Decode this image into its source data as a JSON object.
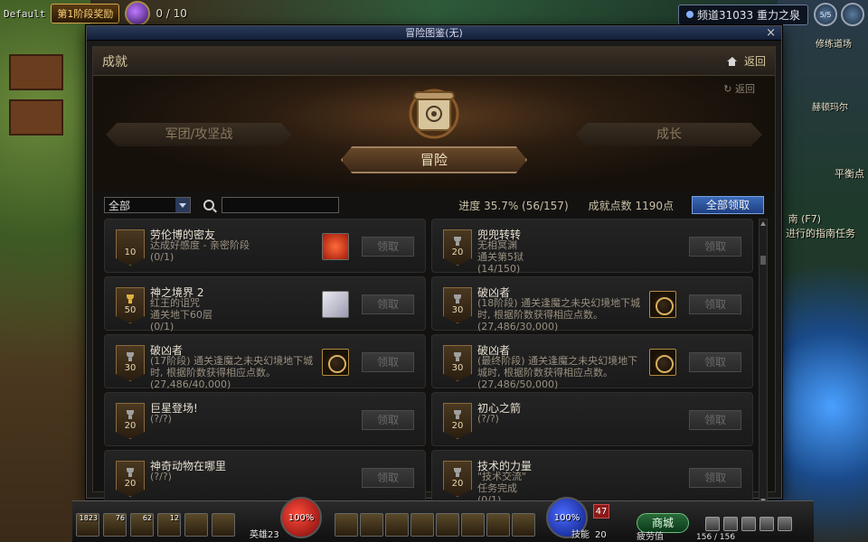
{
  "hud_top": {
    "default_label": "Default",
    "event_label": "第1阶段奖励",
    "counter": "0 / 10",
    "channel": "频道31033 重力之泉",
    "round_btn_label": "5/5"
  },
  "side_notes": {
    "npc_sign_1": "修练道场",
    "npc_name": "赫顿玛尔",
    "balance": "平衡点",
    "guide_key": "南 (F7)",
    "guide_task": "进行的指南任务"
  },
  "window": {
    "title": "冒险图鉴(无)",
    "close_label": "×",
    "panel_title": "成就",
    "back_label": "返回",
    "back_small_label": "返回"
  },
  "category_tabs": {
    "left": "军团/攻坚战",
    "center": "冒险",
    "right": "成长"
  },
  "filter": {
    "selected": "全部",
    "search_placeholder": "",
    "progress": "进度  35.7% (56/157)",
    "points": "成就点数  1190点",
    "claim_all": "全部领取"
  },
  "achievements": [
    {
      "points": "10",
      "trophy": "none",
      "title": "劳伦博的密友",
      "desc": "达成好感度 - 亲密阶段",
      "progress": "(0/1)",
      "reward": "heart",
      "button": "领取"
    },
    {
      "points": "20",
      "trophy": "silver",
      "title": "兜兜转转",
      "desc": "无相冥渊\n通关第5狱",
      "progress": "(14/150)",
      "reward": "",
      "button": "领取"
    },
    {
      "points": "50",
      "trophy": "gold",
      "title": "神之境界 2",
      "desc": "红王的诅咒\n通关地下60层",
      "progress": "(0/1)",
      "reward": "scroll",
      "button": "领取"
    },
    {
      "points": "30",
      "trophy": "silver",
      "title": "破凶者",
      "desc": "(18阶段) 通关逢魔之未央幻境地下城时, 根据阶数获得相应点数。",
      "progress": "(27,486/30,000)",
      "reward": "emblem",
      "button": "领取"
    },
    {
      "points": "30",
      "trophy": "silver",
      "title": "破凶者",
      "desc": "(17阶段) 通关逢魔之未央幻境地下城时, 根据阶数获得相应点数。",
      "progress": "(27,486/40,000)",
      "reward": "emblem",
      "button": "领取"
    },
    {
      "points": "30",
      "trophy": "silver",
      "title": "破凶者",
      "desc": "(最终阶段) 通关逢魔之未央幻境地下城时, 根据阶数获得相应点数。",
      "progress": "(27,486/50,000)",
      "reward": "emblem",
      "button": "领取"
    },
    {
      "points": "20",
      "trophy": "silver",
      "title": "巨星登场!",
      "desc": "",
      "progress": "(?/?)",
      "reward": "",
      "button": "领取"
    },
    {
      "points": "20",
      "trophy": "silver",
      "title": "初心之箭",
      "desc": "",
      "progress": "(?/?)",
      "reward": "",
      "button": "领取"
    },
    {
      "points": "20",
      "trophy": "silver",
      "title": "神奇动物在哪里",
      "desc": "",
      "progress": "(?/?)",
      "reward": "",
      "button": "领取"
    },
    {
      "points": "20",
      "trophy": "silver",
      "title": "技术的力量",
      "desc": "\"技术交流\"\n任务完成",
      "progress": "(0/1)",
      "reward": "",
      "button": "领取"
    }
  ],
  "hud_bottom": {
    "hp": "100%",
    "mp": "100%",
    "item_counts": [
      "1823",
      "76",
      "62",
      "12"
    ],
    "hero_label": "英雄23",
    "skill_label": "技能",
    "skill_points": "20",
    "level": "47",
    "shop": "商城",
    "fatigue_label": "疲劳值",
    "fatigue_value": "156 / 156"
  }
}
